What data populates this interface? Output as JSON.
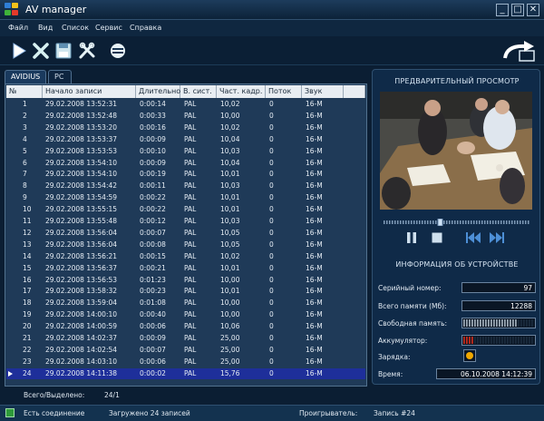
{
  "window": {
    "title": "AV manager",
    "minimize": "_",
    "maximize": "□",
    "close": "✕"
  },
  "colors": {
    "accent": "#1e2f9a",
    "panel": "#1f3a58",
    "header": "#e8edf2",
    "charge": "#f0a800",
    "meter": "#9aa7b3",
    "battery": "#c42a1c"
  },
  "menu": {
    "file": "Файл",
    "view": "Вид",
    "list": "Список",
    "service": "Сервис",
    "help": "Справка"
  },
  "toolbar": {
    "icons": [
      "play-icon",
      "delete-icon",
      "save-icon",
      "settings-tools-icon",
      "connect-icon",
      "export-arrow-icon"
    ]
  },
  "tabs": {
    "tab1": "AVIDIUS",
    "tab2": "PC"
  },
  "grid": {
    "headers": {
      "num": "№",
      "start": "Начало записи",
      "duration": "Длительно",
      "system": "В. сист.",
      "fps": "Част. кадр.",
      "stream": "Поток",
      "sound": "Звук"
    },
    "rows": [
      [
        "1",
        "29.02.2008 13:52:31",
        "0:00:14",
        "PAL",
        "10,02",
        "0",
        "16-M"
      ],
      [
        "2",
        "29.02.2008 13:52:48",
        "0:00:33",
        "PAL",
        "10,00",
        "0",
        "16-M"
      ],
      [
        "3",
        "29.02.2008 13:53:20",
        "0:00:16",
        "PAL",
        "10,02",
        "0",
        "16-M"
      ],
      [
        "4",
        "29.02.2008 13:53:37",
        "0:00:09",
        "PAL",
        "10,04",
        "0",
        "16-M"
      ],
      [
        "5",
        "29.02.2008 13:53:53",
        "0:00:10",
        "PAL",
        "10,03",
        "0",
        "16-M"
      ],
      [
        "6",
        "29.02.2008 13:54:10",
        "0:00:09",
        "PAL",
        "10,04",
        "0",
        "16-M"
      ],
      [
        "7",
        "29.02.2008 13:54:10",
        "0:00:19",
        "PAL",
        "10,01",
        "0",
        "16-M"
      ],
      [
        "8",
        "29.02.2008 13:54:42",
        "0:00:11",
        "PAL",
        "10,03",
        "0",
        "16-M"
      ],
      [
        "9",
        "29.02.2008 13:54:59",
        "0:00:22",
        "PAL",
        "10,01",
        "0",
        "16-M"
      ],
      [
        "10",
        "29.02.2008 13:55:15",
        "0:00:22",
        "PAL",
        "10,01",
        "0",
        "16-M"
      ],
      [
        "11",
        "29.02.2008 13:55:48",
        "0:00:12",
        "PAL",
        "10,03",
        "0",
        "16-M"
      ],
      [
        "12",
        "29.02.2008 13:56:04",
        "0:00:07",
        "PAL",
        "10,05",
        "0",
        "16-M"
      ],
      [
        "13",
        "29.02.2008 13:56:04",
        "0:00:08",
        "PAL",
        "10,05",
        "0",
        "16-M"
      ],
      [
        "14",
        "29.02.2008 13:56:21",
        "0:00:15",
        "PAL",
        "10,02",
        "0",
        "16-M"
      ],
      [
        "15",
        "29.02.2008 13:56:37",
        "0:00:21",
        "PAL",
        "10,01",
        "0",
        "16-M"
      ],
      [
        "16",
        "29.02.2008 13:56:53",
        "0:01:23",
        "PAL",
        "10,00",
        "0",
        "16-M"
      ],
      [
        "17",
        "29.02.2008 13:58:32",
        "0:00:23",
        "PAL",
        "10,01",
        "0",
        "16-M"
      ],
      [
        "18",
        "29.02.2008 13:59:04",
        "0:01:08",
        "PAL",
        "10,00",
        "0",
        "16-M"
      ],
      [
        "19",
        "29.02.2008 14:00:10",
        "0:00:40",
        "PAL",
        "10,00",
        "0",
        "16-M"
      ],
      [
        "20",
        "29.02.2008 14:00:59",
        "0:00:06",
        "PAL",
        "10,06",
        "0",
        "16-M"
      ],
      [
        "21",
        "29.02.2008 14:02:37",
        "0:00:09",
        "PAL",
        "25,00",
        "0",
        "16-M"
      ],
      [
        "22",
        "29.02.2008 14:02:54",
        "0:00:07",
        "PAL",
        "25,00",
        "0",
        "16-M"
      ],
      [
        "23",
        "29.02.2008 14:03:10",
        "0:00:06",
        "PAL",
        "25,00",
        "0",
        "16-M"
      ],
      [
        "24",
        "29.02.2008 14:11:38",
        "0:00:02",
        "PAL",
        "15,76",
        "0",
        "16-M"
      ]
    ],
    "selected_row": 24
  },
  "preview": {
    "title": "ПРЕДВАРИТЕЛЬНЫЙ ПРОСМОТР",
    "position_fraction": 0.38
  },
  "device": {
    "title": "ИНФОРМАЦИЯ ОБ УСТРОЙСТВЕ",
    "serial_label": "Серийный номер:",
    "serial_value": "97",
    "memory_label": "Всего памяти (Мб):",
    "memory_value": "12288",
    "free_label": "Свободная память:",
    "free_fraction": 0.75,
    "battery_label": "Аккумулятор:",
    "battery_fraction": 0.15,
    "charge_label": "Зарядка:",
    "time_label": "Время:",
    "time_value": "06.10.2008 14:12:39"
  },
  "status": {
    "total_label": "Всего/Выделено:",
    "total_value": "24/1",
    "connection": "Есть соединение",
    "loaded": "Загружено 24 записей",
    "player_label": "Проигрыватель:",
    "record": "Запись #24"
  }
}
